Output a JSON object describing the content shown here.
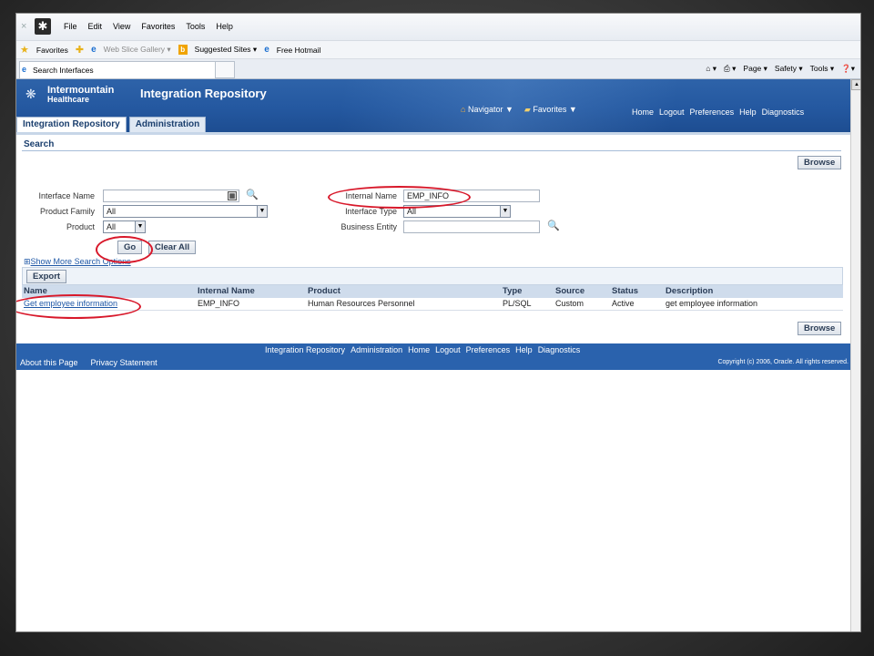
{
  "browser": {
    "close_glyph": "×",
    "menu": [
      "File",
      "Edit",
      "View",
      "Favorites",
      "Tools",
      "Help"
    ],
    "favorites": {
      "label": "Favorites",
      "web_slice": "Web Slice Gallery ▾",
      "suggested": "Suggested Sites ▾",
      "hotmail": "Free Hotmail"
    },
    "tab_title": "Search Interfaces",
    "command_bar": [
      "▾",
      "Page ▾",
      "Safety ▾",
      "Tools ▾",
      "▾"
    ]
  },
  "header": {
    "logo_line1": "Intermountain",
    "logo_line2": "Healthcare",
    "app_title": "Integration Repository",
    "navigator": "Navigator ▼",
    "favorites": "Favorites ▼",
    "links": [
      "Home",
      "Logout",
      "Preferences",
      "Help",
      "Diagnostics"
    ]
  },
  "tabs": [
    "Integration Repository",
    "Administration"
  ],
  "search": {
    "title": "Search",
    "browse_label": "Browse",
    "interface_name_label": "Interface Name",
    "interface_name_value": "",
    "product_family_label": "Product Family",
    "product_family_value": "All",
    "product_label": "Product",
    "product_value": "All",
    "internal_name_label": "Internal Name",
    "internal_name_value": "EMP_INFO",
    "interface_type_label": "Interface Type",
    "interface_type_value": "All",
    "business_entity_label": "Business Entity",
    "business_entity_value": "",
    "go_label": "Go",
    "clear_label": "Clear All",
    "show_more": "Show More Search Options"
  },
  "results": {
    "export_label": "Export",
    "columns": [
      "Name",
      "Internal Name",
      "Product",
      "Type",
      "Source",
      "Status",
      "Description"
    ],
    "rows": [
      {
        "name": "Get employee information",
        "internal_name": "EMP_INFO",
        "product": "Human Resources Personnel",
        "type": "PL/SQL",
        "source": "Custom",
        "status": "Active",
        "description": "get employee information"
      }
    ],
    "browse_label": "Browse"
  },
  "footer": {
    "links": [
      "Integration Repository",
      "Administration",
      "Home",
      "Logout",
      "Preferences",
      "Help",
      "Diagnostics"
    ],
    "about": "About this Page",
    "privacy": "Privacy Statement",
    "copyright": "Copyright (c) 2006, Oracle. All rights reserved."
  },
  "colors": {
    "header_blue": "#2458a0",
    "annotation_red": "#d8182a",
    "link_blue": "#1e57a6"
  }
}
